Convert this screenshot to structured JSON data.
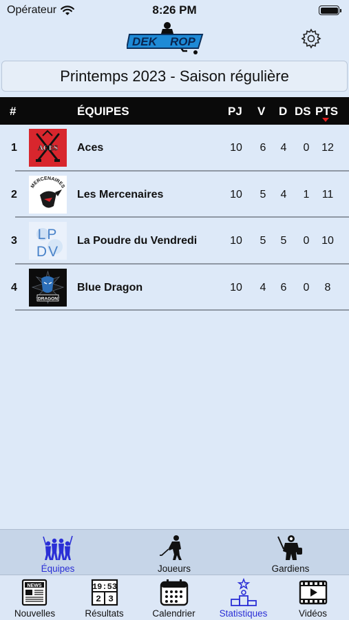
{
  "status": {
    "carrier": "Opérateur",
    "time": "8:26 PM"
  },
  "header": {
    "logo_icon": "dek-rop-logo",
    "settings_icon": "gear-icon"
  },
  "season": {
    "label": "Printemps 2023 - Saison régulière"
  },
  "table": {
    "columns": {
      "rank": "#",
      "team": "ÉQUIPES",
      "gp": "PJ",
      "w": "V",
      "l": "D",
      "otl": "DS",
      "pts": "PTS"
    },
    "sorted_by": "PTS",
    "rows": [
      {
        "rank": "1",
        "team": "Aces",
        "gp": "10",
        "w": "6",
        "l": "4",
        "otl": "0",
        "pts": "12",
        "logo_text": "ACES",
        "logo_icon": "aces-logo"
      },
      {
        "rank": "2",
        "team": "Les Mercenaires",
        "gp": "10",
        "w": "5",
        "l": "4",
        "otl": "1",
        "pts": "11",
        "logo_text": "MERCENAIRES",
        "logo_icon": "mercenaires-logo"
      },
      {
        "rank": "3",
        "team": "La Poudre du Vendredi",
        "gp": "10",
        "w": "5",
        "l": "5",
        "otl": "0",
        "pts": "10",
        "logo_text1": "LP",
        "logo_text2": "DV",
        "logo_icon": "lpdv-logo"
      },
      {
        "rank": "4",
        "team": "Blue Dragon",
        "gp": "10",
        "w": "4",
        "l": "6",
        "otl": "0",
        "pts": "8",
        "logo_text": "DRAGON",
        "logo_icon": "blue-dragon-logo"
      }
    ]
  },
  "subtabs": [
    {
      "label": "Équipes",
      "icon": "team-icon",
      "active": true
    },
    {
      "label": "Joueurs",
      "icon": "player-icon",
      "active": false
    },
    {
      "label": "Gardiens",
      "icon": "goalie-icon",
      "active": false
    }
  ],
  "tabs": [
    {
      "label": "Nouvelles",
      "icon": "news-icon",
      "active": false
    },
    {
      "label": "Résultats",
      "icon": "scoreboard-icon",
      "active": false,
      "board_time": "19:53",
      "board_home": "2",
      "board_away": "3"
    },
    {
      "label": "Calendrier",
      "icon": "calendar-icon",
      "active": false
    },
    {
      "label": "Statistiques",
      "icon": "podium-icon",
      "active": true
    },
    {
      "label": "Vidéos",
      "icon": "video-icon",
      "active": false
    }
  ],
  "colors": {
    "background": "#dde9f8",
    "header_bar": "#0a0a0a",
    "active_tab": "#2b2fd6",
    "sort_arrow": "#e02020",
    "logo_blue": "#1e8ad6"
  }
}
